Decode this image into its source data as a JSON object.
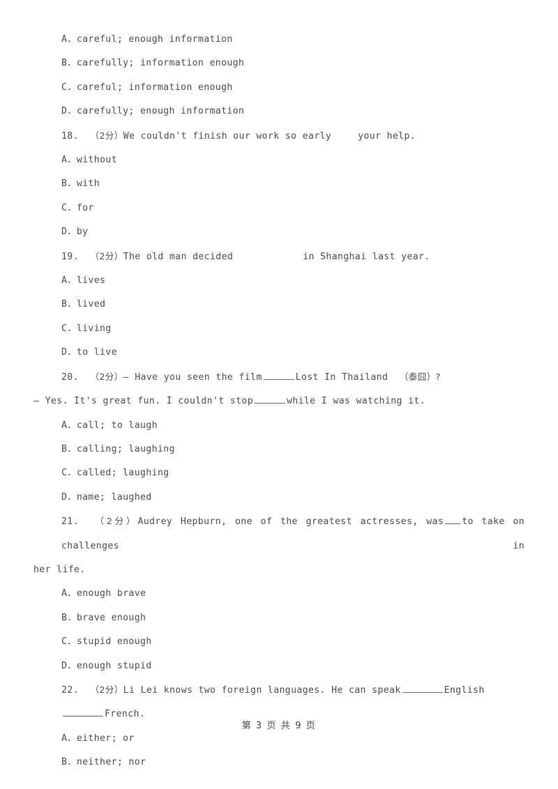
{
  "document": {
    "type": "exam-worksheet",
    "language": "zh-CN/en",
    "text_color": "#4f4f4f",
    "background_color": "#ffffff"
  },
  "footer": {
    "page_label": "第 3 页 共 9 页",
    "current_page": 3,
    "total_pages": 9
  },
  "body": {
    "q17_options": [
      {
        "label": "A．careful; enough information"
      },
      {
        "label": "B．carefully; information enough"
      },
      {
        "label": "C．careful; information enough"
      },
      {
        "label": "D．carefully; enough information"
      }
    ],
    "q18": {
      "number": "18.",
      "points": "（2分）",
      "stem_before": "We couldn't finish our work so early",
      "stem_after": "your help.",
      "options": [
        {
          "label": "A．without"
        },
        {
          "label": "B．with"
        },
        {
          "label": "C．for"
        },
        {
          "label": "D．by"
        }
      ]
    },
    "q19": {
      "number": "19.",
      "points": "（2分）",
      "stem_before": "The old man decided",
      "stem_after": "in Shanghai last year.",
      "options": [
        {
          "label": "A．lives"
        },
        {
          "label": "B．lived"
        },
        {
          "label": "C．living"
        },
        {
          "label": "D．to live"
        }
      ]
    },
    "q20": {
      "number": "20.",
      "points": "（2分）",
      "line1_a": "— Have you seen the film",
      "line1_b": "Lost In Thailand",
      "line1_cjk": "（泰囧）?",
      "line2_a": "— Yes. It's great fun. I couldn't stop",
      "line2_b": "while I was watching it.",
      "options": [
        {
          "label": "A．call; to laugh"
        },
        {
          "label": "B．calling; laughing"
        },
        {
          "label": "C．called; laughing"
        },
        {
          "label": "D．name; laughed"
        }
      ]
    },
    "q21": {
      "number": "21.",
      "points": "（2分）",
      "stem_a": "Audrey Hepburn, one of the greatest actresses, was",
      "stem_b": "to take on challenges in",
      "stem_c": "her life.",
      "options": [
        {
          "label": "A．enough brave"
        },
        {
          "label": "B．brave enough"
        },
        {
          "label": "C．stupid enough"
        },
        {
          "label": "D．enough stupid"
        }
      ]
    },
    "q22": {
      "number": "22.",
      "points": "（2分）",
      "stem_a": "Li Lei knows two foreign languages. He can speak",
      "stem_b": "English",
      "stem_c": "French.",
      "options": [
        {
          "label": "A．either; or"
        },
        {
          "label": "B．neither; nor"
        }
      ]
    }
  }
}
